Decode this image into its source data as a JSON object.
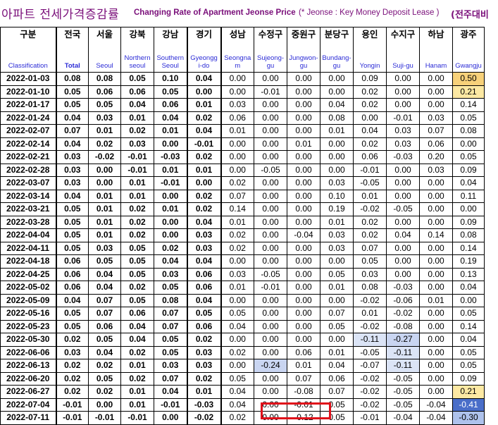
{
  "title": {
    "korean": "아파트 전세가격증감률",
    "english": "Changing Rate of Apartment Jeonse Price",
    "note": "(* Jeonse : Key Money Deposit Lease )",
    "basis": "(전주대비"
  },
  "columns": [
    {
      "kr": "구분",
      "en": "Classification"
    },
    {
      "kr": "전국",
      "en": "Total"
    },
    {
      "kr": "서울",
      "en": "Seoul"
    },
    {
      "kr": "강북",
      "en": "Northern seoul"
    },
    {
      "kr": "강남",
      "en": "Southern Seoul"
    },
    {
      "kr": "경기",
      "en": "Gyeongg i-do"
    },
    {
      "kr": "성남",
      "en": "Seongna m"
    },
    {
      "kr": "수정구",
      "en": "Sujeong-gu"
    },
    {
      "kr": "중원구",
      "en": "Jungwon-gu"
    },
    {
      "kr": "분당구",
      "en": "Bundang-gu"
    },
    {
      "kr": "용인",
      "en": "Yongin"
    },
    {
      "kr": "수지구",
      "en": "Suji-gu"
    },
    {
      "kr": "하남",
      "en": "Hanam"
    },
    {
      "kr": "광주",
      "en": "Gwangju"
    }
  ],
  "rows": [
    [
      "2022-01-03",
      "0.08",
      "0.08",
      "0.05",
      "0.10",
      "0.04",
      "0.00",
      "0.00",
      "0.00",
      "0.00",
      "0.09",
      "0.00",
      "0.00",
      "0.50"
    ],
    [
      "2022-01-10",
      "0.05",
      "0.06",
      "0.06",
      "0.05",
      "0.00",
      "0.00",
      "-0.01",
      "0.00",
      "0.00",
      "0.02",
      "0.00",
      "0.00",
      "0.21"
    ],
    [
      "2022-01-17",
      "0.05",
      "0.05",
      "0.04",
      "0.06",
      "0.01",
      "0.03",
      "0.00",
      "0.00",
      "0.04",
      "0.02",
      "0.00",
      "0.00",
      "0.14"
    ],
    [
      "2022-01-24",
      "0.04",
      "0.03",
      "0.01",
      "0.04",
      "0.02",
      "0.06",
      "0.00",
      "0.00",
      "0.08",
      "0.00",
      "-0.01",
      "0.03",
      "0.05"
    ],
    [
      "2022-02-07",
      "0.07",
      "0.01",
      "0.02",
      "0.01",
      "0.04",
      "0.01",
      "0.00",
      "0.00",
      "0.01",
      "0.04",
      "0.03",
      "0.07",
      "0.08"
    ],
    [
      "2022-02-14",
      "0.04",
      "0.02",
      "0.03",
      "0.00",
      "-0.01",
      "0.00",
      "0.00",
      "0.01",
      "0.00",
      "0.02",
      "0.03",
      "0.06",
      "0.00"
    ],
    [
      "2022-02-21",
      "0.03",
      "-0.02",
      "-0.01",
      "-0.03",
      "0.02",
      "0.00",
      "0.00",
      "0.00",
      "0.00",
      "0.06",
      "-0.03",
      "0.20",
      "0.05"
    ],
    [
      "2022-02-28",
      "0.03",
      "0.00",
      "-0.01",
      "0.01",
      "0.01",
      "0.00",
      "-0.05",
      "0.00",
      "0.00",
      "-0.01",
      "0.00",
      "0.03",
      "0.09"
    ],
    [
      "2022-03-07",
      "0.03",
      "0.00",
      "0.01",
      "-0.01",
      "0.00",
      "0.02",
      "0.00",
      "0.00",
      "0.03",
      "-0.05",
      "0.00",
      "0.00",
      "0.04"
    ],
    [
      "2022-03-14",
      "0.04",
      "0.01",
      "0.01",
      "0.00",
      "0.02",
      "0.07",
      "0.00",
      "0.00",
      "0.10",
      "0.01",
      "0.00",
      "0.00",
      "0.11"
    ],
    [
      "2022-03-21",
      "0.05",
      "0.01",
      "0.02",
      "0.01",
      "0.02",
      "0.14",
      "0.00",
      "0.00",
      "0.19",
      "-0.02",
      "-0.05",
      "0.00",
      "0.00"
    ],
    [
      "2022-03-28",
      "0.05",
      "0.01",
      "0.02",
      "0.00",
      "0.04",
      "0.01",
      "0.00",
      "0.00",
      "0.01",
      "0.02",
      "0.00",
      "0.00",
      "0.09"
    ],
    [
      "2022-04-04",
      "0.05",
      "0.01",
      "0.02",
      "0.00",
      "0.03",
      "0.02",
      "0.00",
      "-0.04",
      "0.03",
      "0.02",
      "0.04",
      "0.14",
      "0.08"
    ],
    [
      "2022-04-11",
      "0.05",
      "0.03",
      "0.05",
      "0.02",
      "0.03",
      "0.02",
      "0.00",
      "0.00",
      "0.03",
      "0.07",
      "0.00",
      "0.00",
      "0.14"
    ],
    [
      "2022-04-18",
      "0.06",
      "0.05",
      "0.05",
      "0.04",
      "0.04",
      "0.00",
      "0.00",
      "0.00",
      "0.00",
      "0.05",
      "0.00",
      "0.00",
      "0.19"
    ],
    [
      "2022-04-25",
      "0.06",
      "0.04",
      "0.05",
      "0.03",
      "0.06",
      "0.03",
      "-0.05",
      "0.00",
      "0.05",
      "0.03",
      "0.00",
      "0.00",
      "0.13"
    ],
    [
      "2022-05-02",
      "0.06",
      "0.04",
      "0.02",
      "0.05",
      "0.06",
      "0.01",
      "-0.01",
      "0.00",
      "0.01",
      "0.08",
      "-0.03",
      "0.00",
      "0.04"
    ],
    [
      "2022-05-09",
      "0.04",
      "0.07",
      "0.05",
      "0.08",
      "0.04",
      "0.00",
      "0.00",
      "0.00",
      "0.00",
      "-0.02",
      "-0.06",
      "0.01",
      "0.00"
    ],
    [
      "2022-05-16",
      "0.05",
      "0.07",
      "0.06",
      "0.07",
      "0.05",
      "0.05",
      "0.00",
      "0.00",
      "0.07",
      "0.01",
      "-0.02",
      "0.00",
      "0.05"
    ],
    [
      "2022-05-23",
      "0.05",
      "0.06",
      "0.04",
      "0.07",
      "0.06",
      "0.04",
      "0.00",
      "0.00",
      "0.05",
      "-0.02",
      "-0.08",
      "0.00",
      "0.14"
    ],
    [
      "2022-05-30",
      "0.02",
      "0.05",
      "0.04",
      "0.05",
      "0.02",
      "0.00",
      "0.00",
      "0.00",
      "0.00",
      "-0.11",
      "-0.27",
      "0.00",
      "0.04"
    ],
    [
      "2022-06-06",
      "0.03",
      "0.04",
      "0.02",
      "0.05",
      "0.03",
      "0.02",
      "0.00",
      "0.06",
      "0.01",
      "-0.05",
      "-0.11",
      "0.00",
      "0.05"
    ],
    [
      "2022-06-13",
      "0.02",
      "0.02",
      "0.01",
      "0.03",
      "0.03",
      "0.00",
      "-0.24",
      "0.01",
      "0.04",
      "-0.07",
      "-0.11",
      "0.00",
      "0.05"
    ],
    [
      "2022-06-20",
      "0.02",
      "0.05",
      "0.02",
      "0.07",
      "0.02",
      "0.05",
      "0.00",
      "0.07",
      "0.06",
      "-0.02",
      "-0.05",
      "0.00",
      "0.09"
    ],
    [
      "2022-06-27",
      "0.02",
      "0.02",
      "0.01",
      "0.04",
      "0.01",
      "0.04",
      "0.00",
      "-0.08",
      "0.07",
      "-0.02",
      "-0.05",
      "0.00",
      "0.21"
    ],
    [
      "2022-07-04",
      "-0.01",
      "0.00",
      "0.01",
      "-0.01",
      "-0.03",
      "0.04",
      "0.00",
      "-0.01",
      "0.05",
      "-0.02",
      "-0.05",
      "-0.04",
      "-0.41"
    ],
    [
      "2022-07-11",
      "-0.01",
      "-0.01",
      "-0.01",
      "0.00",
      "-0.02",
      "0.02",
      "0.00",
      "-0.12",
      "0.05",
      "-0.01",
      "-0.04",
      "-0.04",
      "-0.30"
    ]
  ],
  "highlight_colors": {
    "strong_positive": "#f7d17a",
    "mild_positive": "#fde9a3",
    "mild_negative": "#dbe4f6",
    "negative": "#aec2ec",
    "strong_negative": "#365fc0",
    "title": "#7a0f7a",
    "header_english": "#2b2bd6",
    "callout_box": "#e0101a"
  }
}
